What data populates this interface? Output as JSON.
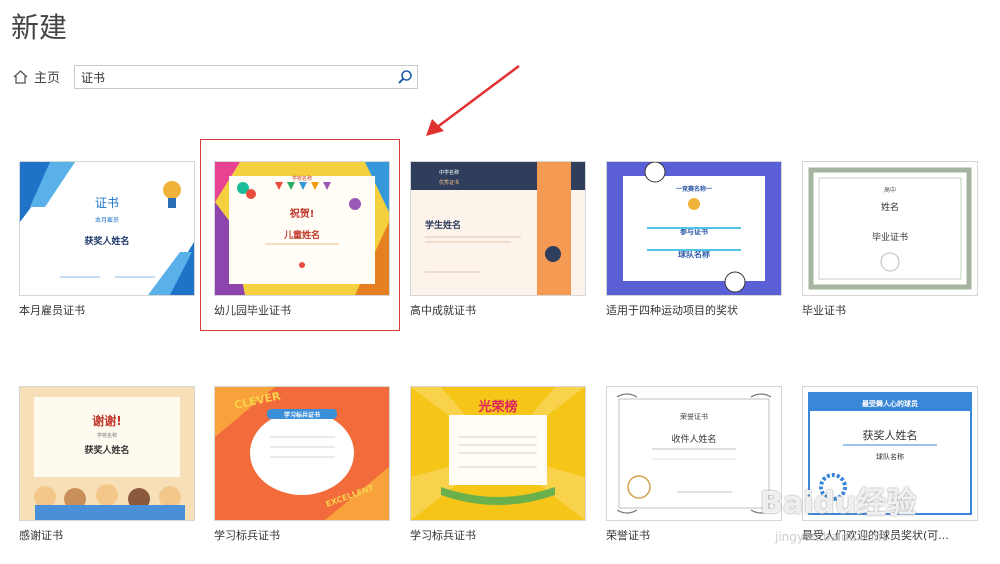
{
  "page": {
    "title": "新建"
  },
  "nav": {
    "home_label": "主页"
  },
  "search": {
    "value": "证书",
    "icon": "search-icon"
  },
  "templates": [
    {
      "label": "本月雇员证书",
      "thumb": {
        "line1": "证书",
        "line2": "本月雇员",
        "line3": "获奖人姓名"
      }
    },
    {
      "label": "幼儿园毕业证书",
      "thumb": {
        "line1": "学校名称",
        "line2": "祝贺!",
        "line3": "儿童姓名"
      }
    },
    {
      "label": "高中成就证书",
      "thumb": {
        "line1": "中学名称",
        "line2": "优秀证书",
        "line3": "学生姓名"
      }
    },
    {
      "label": "适用于四种运动项目的奖状",
      "thumb": {
        "line1": "一竞赛名称一",
        "line2": "参与证书",
        "line3": "球队名称"
      }
    },
    {
      "label": "毕业证书",
      "thumb": {
        "line1": "高中",
        "line2": "姓名",
        "line3": "毕业证书"
      }
    },
    {
      "label": "感谢证书",
      "thumb": {
        "line1": "谢谢!",
        "line2": "学校名称",
        "line3": "获奖人姓名"
      }
    },
    {
      "label": "学习标兵证书",
      "thumb": {
        "line1": "CLEVER",
        "line2": "学习标兵证书",
        "line3": "EXCELLENT"
      }
    },
    {
      "label": "学习标兵证书",
      "thumb": {
        "line1": "光荣榜",
        "line2": "",
        "line3": ""
      }
    },
    {
      "label": "荣誉证书",
      "thumb": {
        "line1": "荣誉证书",
        "line2": "收件人姓名",
        "line3": ""
      }
    },
    {
      "label": "最受人们欢迎的球员奖状(可...",
      "thumb": {
        "line1": "最受舞人心的球员",
        "line2": "获奖人姓名",
        "line3": "球队名称"
      }
    }
  ],
  "watermark": {
    "brand": "Baidu经验",
    "url": "jingyan.baidu.com"
  }
}
